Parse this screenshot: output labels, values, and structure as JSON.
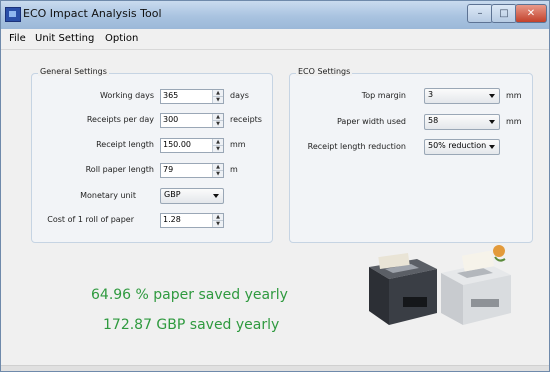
{
  "window": {
    "title": "ECO Impact Analysis Tool",
    "controls": {
      "minimize": "–",
      "maximize": "□",
      "close": "✕"
    }
  },
  "menu": {
    "file": "File",
    "unit_setting": "Unit Setting",
    "option": "Option"
  },
  "general": {
    "title": "General Settings",
    "working_days": {
      "label": "Working days",
      "value": "365",
      "unit": "days"
    },
    "receipts_per_day": {
      "label": "Receipts per day",
      "value": "300",
      "unit": "receipts"
    },
    "receipt_length": {
      "label": "Receipt length",
      "value": "150.00",
      "unit": "mm"
    },
    "roll_paper_length": {
      "label": "Roll paper length",
      "value": "79",
      "unit": "m"
    },
    "monetary_unit": {
      "label": "Monetary unit",
      "value": "GBP"
    },
    "cost_roll": {
      "label": "Cost of 1 roll of paper",
      "value": "1.28"
    }
  },
  "eco": {
    "title": "ECO Settings",
    "top_margin": {
      "label": "Top margin",
      "value": "3",
      "unit": "mm"
    },
    "paper_width": {
      "label": "Paper width used",
      "value": "58",
      "unit": "mm"
    },
    "receipt_reduction": {
      "label": "Receipt length reduction",
      "value": "50% reduction"
    }
  },
  "results": {
    "paper_saved": "64.96 % paper saved yearly",
    "money_saved": "172.87 GBP saved yearly"
  },
  "colors": {
    "result_green": "#2f9a3f",
    "title_bar": "#a9c3e0"
  },
  "icons": {
    "app": "app-icon",
    "spin": "spinner-arrows-icon",
    "dropdown": "chevron-down-icon"
  }
}
